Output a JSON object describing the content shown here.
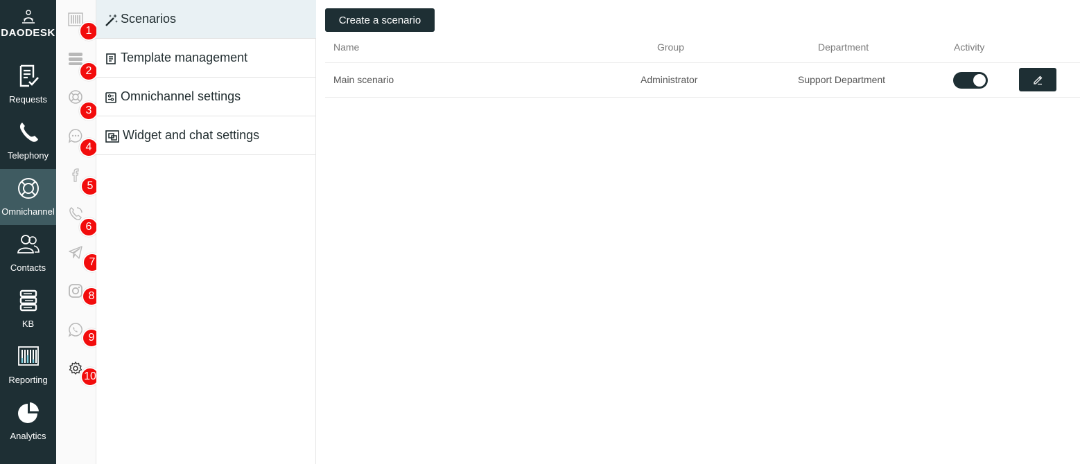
{
  "brand": {
    "name": "DAODESK"
  },
  "nav": [
    {
      "label": "Requests",
      "icon": "requests-icon"
    },
    {
      "label": "Telephony",
      "icon": "phone-icon"
    },
    {
      "label": "Omnichannel",
      "icon": "lifebuoy-icon",
      "active": true
    },
    {
      "label": "Contacts",
      "icon": "contacts-icon"
    },
    {
      "label": "KB",
      "icon": "books-icon"
    },
    {
      "label": "Reporting",
      "icon": "reporting-icon"
    },
    {
      "label": "Analytics",
      "icon": "pie-chart-icon"
    }
  ],
  "channel_badges": [
    "1",
    "2",
    "3",
    "4",
    "5",
    "6",
    "7",
    "8",
    "9",
    "10"
  ],
  "channel_icons": [
    "barcode-icon",
    "layers-icon",
    "lifebuoy-icon",
    "chat-bubble-icon",
    "facebook-icon",
    "viber-icon",
    "telegram-icon",
    "instagram-icon",
    "whatsapp-icon",
    "gear-icon"
  ],
  "submenu": [
    {
      "label": "Scenarios",
      "icon": "magic-wand-icon",
      "active": true
    },
    {
      "label": "Template management",
      "icon": "document-icon"
    },
    {
      "label": "Omnichannel settings",
      "icon": "sliders-icon"
    },
    {
      "label": "Widget and chat settings",
      "icon": "widget-icon"
    }
  ],
  "main": {
    "create_button": "Create a scenario",
    "columns": {
      "name": "Name",
      "group": "Group",
      "department": "Department",
      "activity": "Activity"
    },
    "rows": [
      {
        "name": "Main scenario",
        "group": "Administrator",
        "department": "Support Department",
        "active": true
      }
    ]
  },
  "colors": {
    "nav_bg": "#1e2f34",
    "nav_active": "#3f5b61",
    "badge": "#f20c0c",
    "submenu_active": "#e9f1f4"
  }
}
